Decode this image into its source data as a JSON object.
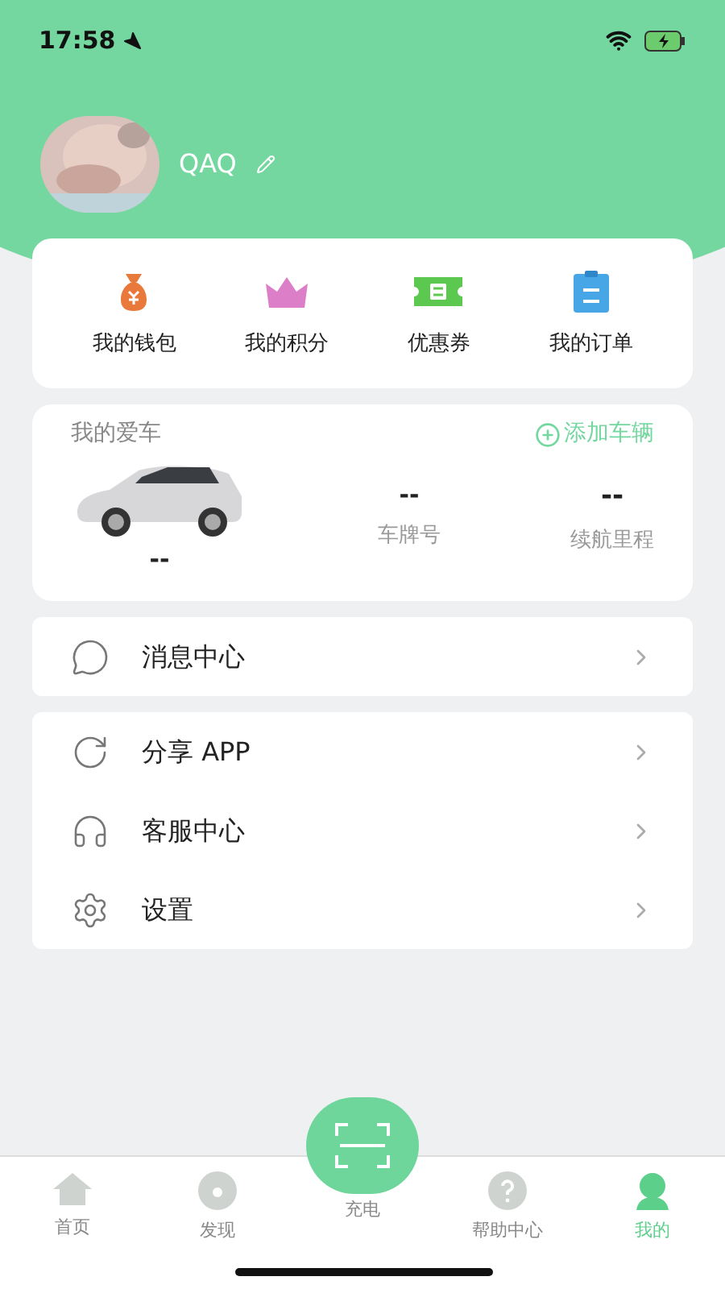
{
  "status_bar": {
    "time": "17:58"
  },
  "profile": {
    "name": "QAQ"
  },
  "quick_actions": [
    {
      "kind": "wallet",
      "label": "我的钱包"
    },
    {
      "kind": "points",
      "label": "我的积分"
    },
    {
      "kind": "coupon",
      "label": "优惠券"
    },
    {
      "kind": "orders",
      "label": "我的订单"
    }
  ],
  "my_car": {
    "title": "我的爱车",
    "add_button": "添加车辆",
    "car_name": "--",
    "plate_value": "--",
    "plate_label": "车牌号",
    "range_value": "--",
    "range_label": "续航里程"
  },
  "menu_groups": [
    [
      {
        "kind": "message",
        "label": "消息中心"
      }
    ],
    [
      {
        "kind": "share",
        "label": "分享 APP"
      },
      {
        "kind": "service",
        "label": "客服中心"
      },
      {
        "kind": "settings",
        "label": "设置"
      }
    ]
  ],
  "tab_bar": [
    {
      "kind": "home",
      "label": "首页",
      "selected": false
    },
    {
      "kind": "discover",
      "label": "发现",
      "selected": false
    },
    {
      "kind": "scan",
      "label": "充电",
      "selected": false
    },
    {
      "kind": "help",
      "label": "帮助中心",
      "selected": false
    },
    {
      "kind": "me",
      "label": "我的",
      "selected": true
    }
  ]
}
